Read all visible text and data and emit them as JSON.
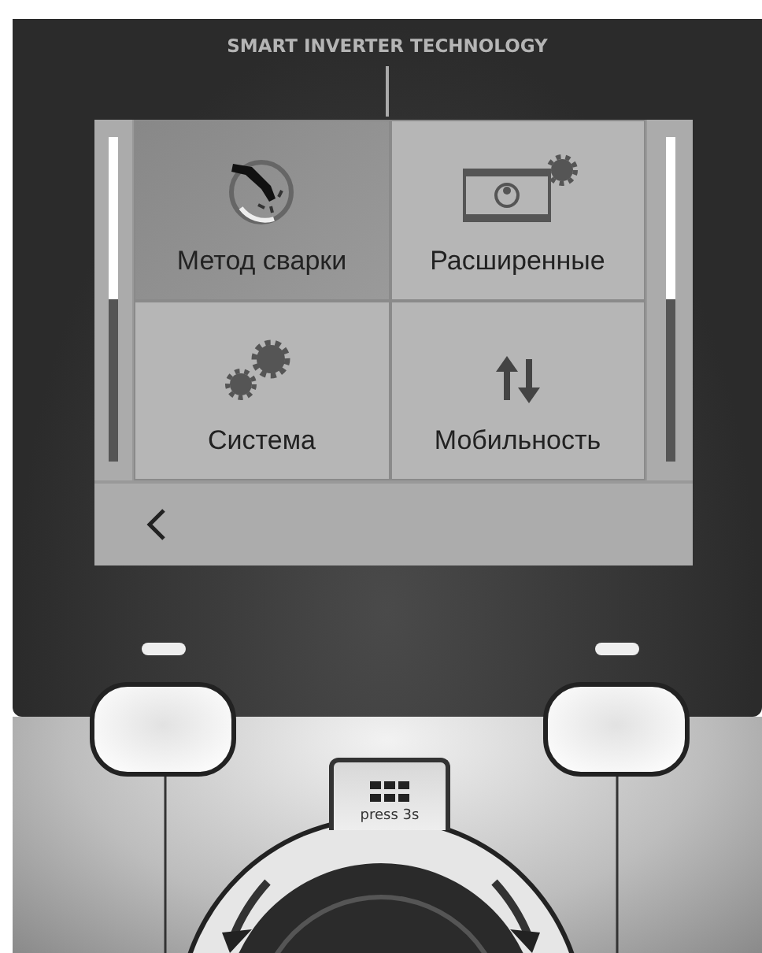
{
  "brand_label": "SMART INVERTER TECHNOLOGY",
  "menu": {
    "tiles": [
      {
        "label": "Метод сварки",
        "kind": "torch",
        "selected": true
      },
      {
        "label": "Расширенные",
        "kind": "monitor",
        "selected": false
      },
      {
        "label": "Система",
        "kind": "gears",
        "selected": false
      },
      {
        "label": "Мобильность",
        "kind": "arrows",
        "selected": false
      }
    ]
  },
  "center_key": {
    "label": "press 3s"
  }
}
